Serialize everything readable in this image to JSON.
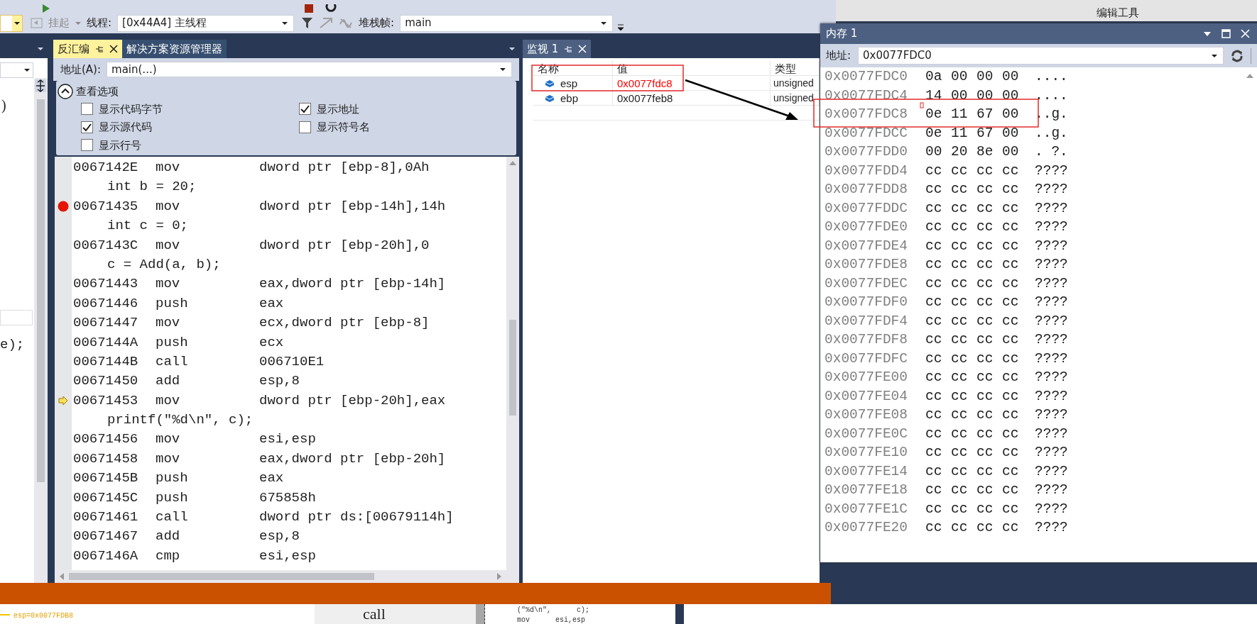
{
  "toolbar": {
    "suspend_label": "挂起",
    "thread_label": "线程:",
    "thread_value": "[0x44A4] 主线程",
    "stack_frame_label": "堆栈帧:",
    "stack_frame_value": "main"
  },
  "desktop_labels": [
    "编辑工具"
  ],
  "left_code_fragments": [
    ")",
    "e);"
  ],
  "disassembly": {
    "tabs": [
      {
        "label": "反汇编",
        "selected": true
      },
      {
        "label": "解决方案资源管理器",
        "selected": false
      }
    ],
    "address_label": "地址(A):",
    "address_value": "main(...)",
    "options_title": "查看选项",
    "options_expanded": true,
    "options": [
      {
        "label": "显示代码字节",
        "checked": false
      },
      {
        "label": "显示地址",
        "checked": true
      },
      {
        "label": "显示源代码",
        "checked": true
      },
      {
        "label": "显示符号名",
        "checked": false
      },
      {
        "label": "显示行号",
        "checked": false
      }
    ],
    "lines": [
      {
        "kind": "asm",
        "address": "0067142E",
        "op": "mov",
        "operand": "dword ptr [ebp-8],0Ah",
        "breakpoint": false,
        "current": false
      },
      {
        "kind": "source",
        "text": "int b = 20;"
      },
      {
        "kind": "asm",
        "address": "00671435",
        "op": "mov",
        "operand": "dword ptr [ebp-14h],14h",
        "breakpoint": true,
        "current": false
      },
      {
        "kind": "source",
        "text": "int c = 0;"
      },
      {
        "kind": "asm",
        "address": "0067143C",
        "op": "mov",
        "operand": "dword ptr [ebp-20h],0",
        "breakpoint": false,
        "current": false
      },
      {
        "kind": "source",
        "text": "c = Add(a, b);"
      },
      {
        "kind": "asm",
        "address": "00671443",
        "op": "mov",
        "operand": "eax,dword ptr [ebp-14h]",
        "breakpoint": false,
        "current": false
      },
      {
        "kind": "asm",
        "address": "00671446",
        "op": "push",
        "operand": "eax",
        "breakpoint": false,
        "current": false
      },
      {
        "kind": "asm",
        "address": "00671447",
        "op": "mov",
        "operand": "ecx,dword ptr [ebp-8]",
        "breakpoint": false,
        "current": false
      },
      {
        "kind": "asm",
        "address": "0067144A",
        "op": "push",
        "operand": "ecx",
        "breakpoint": false,
        "current": false
      },
      {
        "kind": "asm",
        "address": "0067144B",
        "op": "call",
        "operand": "006710E1",
        "breakpoint": false,
        "current": false
      },
      {
        "kind": "asm",
        "address": "00671450",
        "op": "add",
        "operand": "esp,8",
        "breakpoint": false,
        "current": false
      },
      {
        "kind": "asm",
        "address": "00671453",
        "op": "mov",
        "operand": "dword ptr [ebp-20h],eax",
        "breakpoint": false,
        "current": true
      },
      {
        "kind": "source",
        "text": "printf(″%d\\n″, c);"
      },
      {
        "kind": "asm",
        "address": "00671456",
        "op": "mov",
        "operand": "esi,esp",
        "breakpoint": false,
        "current": false
      },
      {
        "kind": "asm",
        "address": "00671458",
        "op": "mov",
        "operand": "eax,dword ptr [ebp-20h]",
        "breakpoint": false,
        "current": false
      },
      {
        "kind": "asm",
        "address": "0067145B",
        "op": "push",
        "operand": "eax",
        "breakpoint": false,
        "current": false
      },
      {
        "kind": "asm",
        "address": "0067145C",
        "op": "push",
        "operand": "675858h",
        "breakpoint": false,
        "current": false
      },
      {
        "kind": "asm",
        "address": "00671461",
        "op": "call",
        "operand": "dword ptr ds:[00679114h]",
        "breakpoint": false,
        "current": false
      },
      {
        "kind": "asm",
        "address": "00671467",
        "op": "add",
        "operand": "esp,8",
        "breakpoint": false,
        "current": false
      },
      {
        "kind": "asm",
        "address": "0067146A",
        "op": "cmp",
        "operand": "esi,esp",
        "breakpoint": false,
        "current": false
      }
    ]
  },
  "watch": {
    "tab": {
      "label": "监视 1",
      "selected": true
    },
    "columns": [
      "名称",
      "值",
      "类型"
    ],
    "rows": [
      {
        "name": "esp",
        "value": "0x0077fdc8",
        "type": "unsigned",
        "changed": true
      },
      {
        "name": "ebp",
        "value": "0x0077feb8",
        "type": "unsigned",
        "changed": false
      }
    ]
  },
  "memory": {
    "title": "内存 1",
    "address_label": "地址:",
    "address_value": "0x0077FDC0",
    "rows": [
      {
        "address": "0x0077FDC0",
        "bytes": [
          "0a",
          "00",
          "00",
          "00"
        ],
        "chars": "...."
      },
      {
        "address": "0x0077FDC4",
        "bytes": [
          "14",
          "00",
          "00",
          "00"
        ],
        "chars": "...."
      },
      {
        "address": "0x0077FDC8",
        "bytes": [
          "0e",
          "11",
          "67",
          "00"
        ],
        "chars": "..g."
      },
      {
        "address": "0x0077FDCC",
        "bytes": [
          "0e",
          "11",
          "67",
          "00"
        ],
        "chars": "..g."
      },
      {
        "address": "0x0077FDD0",
        "bytes": [
          "00",
          "20",
          "8e",
          "00"
        ],
        "chars": ". ?."
      },
      {
        "address": "0x0077FDD4",
        "bytes": [
          "cc",
          "cc",
          "cc",
          "cc"
        ],
        "chars": "????"
      },
      {
        "address": "0x0077FDD8",
        "bytes": [
          "cc",
          "cc",
          "cc",
          "cc"
        ],
        "chars": "????"
      },
      {
        "address": "0x0077FDDC",
        "bytes": [
          "cc",
          "cc",
          "cc",
          "cc"
        ],
        "chars": "????"
      },
      {
        "address": "0x0077FDE0",
        "bytes": [
          "cc",
          "cc",
          "cc",
          "cc"
        ],
        "chars": "????"
      },
      {
        "address": "0x0077FDE4",
        "bytes": [
          "cc",
          "cc",
          "cc",
          "cc"
        ],
        "chars": "????"
      },
      {
        "address": "0x0077FDE8",
        "bytes": [
          "cc",
          "cc",
          "cc",
          "cc"
        ],
        "chars": "????"
      },
      {
        "address": "0x0077FDEC",
        "bytes": [
          "cc",
          "cc",
          "cc",
          "cc"
        ],
        "chars": "????"
      },
      {
        "address": "0x0077FDF0",
        "bytes": [
          "cc",
          "cc",
          "cc",
          "cc"
        ],
        "chars": "????"
      },
      {
        "address": "0x0077FDF4",
        "bytes": [
          "cc",
          "cc",
          "cc",
          "cc"
        ],
        "chars": "????"
      },
      {
        "address": "0x0077FDF8",
        "bytes": [
          "cc",
          "cc",
          "cc",
          "cc"
        ],
        "chars": "????"
      },
      {
        "address": "0x0077FDFC",
        "bytes": [
          "cc",
          "cc",
          "cc",
          "cc"
        ],
        "chars": "????"
      },
      {
        "address": "0x0077FE00",
        "bytes": [
          "cc",
          "cc",
          "cc",
          "cc"
        ],
        "chars": "????"
      },
      {
        "address": "0x0077FE04",
        "bytes": [
          "cc",
          "cc",
          "cc",
          "cc"
        ],
        "chars": "????"
      },
      {
        "address": "0x0077FE08",
        "bytes": [
          "cc",
          "cc",
          "cc",
          "cc"
        ],
        "chars": "????"
      },
      {
        "address": "0x0077FE0C",
        "bytes": [
          "cc",
          "cc",
          "cc",
          "cc"
        ],
        "chars": "????"
      },
      {
        "address": "0x0077FE10",
        "bytes": [
          "cc",
          "cc",
          "cc",
          "cc"
        ],
        "chars": "????"
      },
      {
        "address": "0x0077FE14",
        "bytes": [
          "cc",
          "cc",
          "cc",
          "cc"
        ],
        "chars": "????"
      },
      {
        "address": "0x0077FE18",
        "bytes": [
          "cc",
          "cc",
          "cc",
          "cc"
        ],
        "chars": "????"
      },
      {
        "address": "0x0077FE1C",
        "bytes": [
          "cc",
          "cc",
          "cc",
          "cc"
        ],
        "chars": "????"
      },
      {
        "address": "0x0077FE20",
        "bytes": [
          "cc",
          "cc",
          "cc",
          "cc"
        ],
        "chars": "????"
      }
    ]
  },
  "background_window": {
    "watch_tip": "esp=0x0077FDB8",
    "button_text": "call",
    "code_lines": [
      "(″%d\\n″, c);",
      "mov esi,esp"
    ]
  }
}
